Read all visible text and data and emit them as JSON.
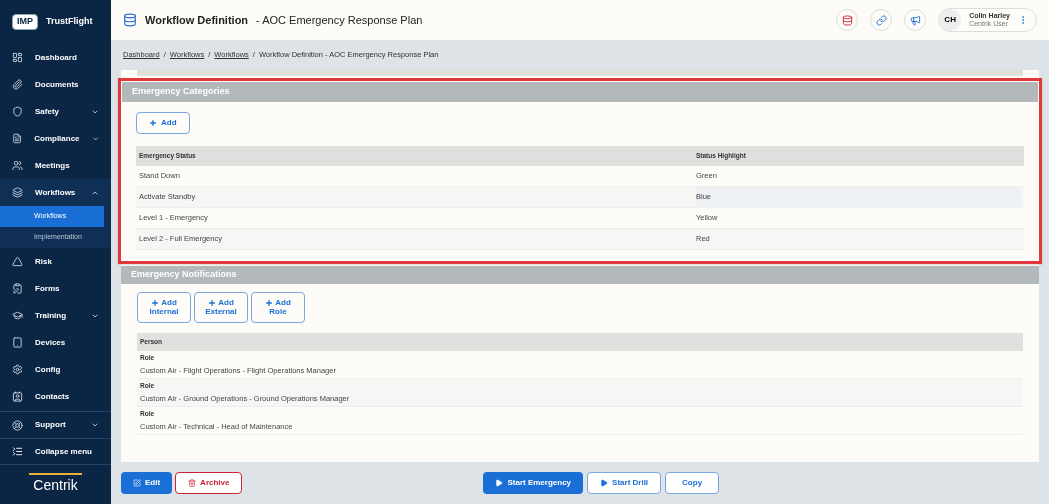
{
  "brand": {
    "badge": "IMP",
    "name": "TrustFlight"
  },
  "sidebar": {
    "items": [
      {
        "label": "Dashboard",
        "selected": false
      },
      {
        "label": "Documents",
        "selected": false
      },
      {
        "label": "Safety",
        "selected": false,
        "expanded": false
      },
      {
        "label": "Compliance",
        "selected": false,
        "expanded": false
      },
      {
        "label": "Meetings",
        "selected": false
      },
      {
        "label": "Workflows",
        "selected": false,
        "expanded": true,
        "children": [
          {
            "label": "Workflows",
            "selected": true
          },
          {
            "label": "Implementation",
            "selected": false
          }
        ]
      },
      {
        "label": "Risk",
        "selected": false
      },
      {
        "label": "Forms",
        "selected": false
      },
      {
        "label": "Training",
        "selected": false,
        "expanded": false
      },
      {
        "label": "Devices",
        "selected": false
      },
      {
        "label": "Config",
        "selected": false
      },
      {
        "label": "Contacts",
        "selected": false
      }
    ],
    "support": {
      "label": "Support",
      "expanded": false
    },
    "collapse": "Collapse menu",
    "footer_logo": "Centrik"
  },
  "header": {
    "title": "Workflow Definition",
    "subtitle": "- AOC Emergency Response Plan",
    "user": {
      "initials": "CH",
      "name": "Colin Harley",
      "role": "Centrik User"
    }
  },
  "breadcrumb": {
    "separator": "/",
    "items": [
      "Dashboard",
      "Workflows",
      "Workflows",
      "Workflow Definition - AOC Emergency Response Plan"
    ]
  },
  "categories": {
    "title": "Emergency Categories",
    "add": "Add",
    "columns": [
      "Emergency Status",
      "Status Highlight"
    ],
    "rows": [
      {
        "status": "Stand Down",
        "highlight": "Green"
      },
      {
        "status": "Activate Standby",
        "highlight": "Blue"
      },
      {
        "status": "Level 1 - Emergency",
        "highlight": "Yellow"
      },
      {
        "status": "Level 2 - Full Emergency",
        "highlight": "Red"
      }
    ]
  },
  "notifications": {
    "title": "Emergency Notifications",
    "buttons": [
      [
        "Add",
        "Internal"
      ],
      [
        "Add",
        "External"
      ],
      [
        "Add",
        "Role"
      ]
    ],
    "columns": [
      "Person"
    ],
    "rows": [
      {
        "type": "Role",
        "name": "Custom Air - Flight Operations - Flight Operations Manager"
      },
      {
        "type": "Role",
        "name": "Custom Air - Ground Operations - Ground Operations Manager"
      },
      {
        "type": "Role",
        "name": "Custom Air - Technical - Head of Maintenance"
      }
    ]
  },
  "footer": {
    "edit": "Edit",
    "archive": "Archive",
    "start_emergency": "Start Emergency",
    "start_drill": "Start Drill",
    "copy": "Copy"
  }
}
